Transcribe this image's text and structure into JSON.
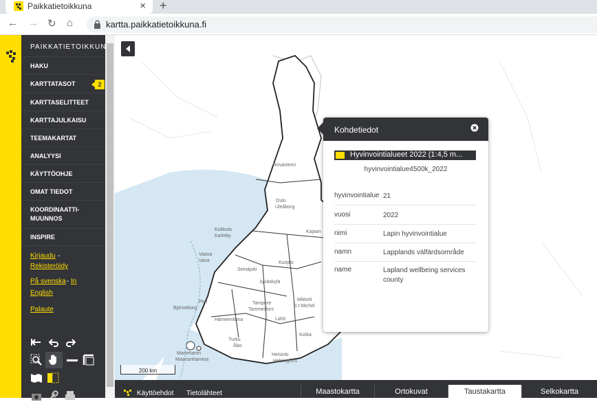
{
  "browser": {
    "tab_title": "Paikkatietoikkuna",
    "new_tab": "+",
    "close_tab": "×",
    "url": "kartta.paikkatietoikkuna.fi"
  },
  "sidebar": {
    "brand": "PAIKKATIETOIKKUNA",
    "items": [
      {
        "label": "HAKU"
      },
      {
        "label": "KARTTATASOT",
        "badge": "2"
      },
      {
        "label": "KARTTASELITTEET"
      },
      {
        "label": "KARTTAJULKAISU"
      },
      {
        "label": "TEEMAKARTAT"
      },
      {
        "label": "ANALYYSI"
      },
      {
        "label": "KÄYTTÖOHJE"
      },
      {
        "label": "OMAT TIEDOT"
      },
      {
        "label_line1": "KOORDINAATTI-",
        "label_line2": "MUUNNOS"
      },
      {
        "label": "INSPIRE"
      }
    ],
    "login": "Kirjaudu",
    "register": "Rekisteröidy",
    "lang_sv": "På svenska",
    "lang_sep": "-",
    "lang_en_1": "In",
    "lang_en_2": "English",
    "feedback": "Palaute",
    "login_sep": "-"
  },
  "map": {
    "scale": "200 km",
    "places": [
      "Rovaniemi",
      "Oulu",
      "Uleåborg",
      "Kokkola",
      "Karleby",
      "Vaasa",
      "Vasa",
      "Kajaan",
      "Seinäjoki",
      "Jyväskylä",
      "Kuopio",
      "Pori",
      "Björneborg",
      "Tampere",
      "Tammerfors",
      "Mikkeli",
      "S:t Michel",
      "Hämeenlinna",
      "Lahti",
      "Kotka",
      "Turku",
      "Åbo",
      "Mariehamn",
      "Maarianhamina",
      "Helsinki",
      "Helsingfors"
    ]
  },
  "popup": {
    "title": "Kohdetiedot",
    "layer": "Hyvinvointialueet 2022 (1:4,5 m...",
    "layer_id": "hyvinvointialue4500k_2022",
    "rows": [
      {
        "key": "hyvinvointialue",
        "value": "21"
      },
      {
        "key": "vuosi",
        "value": "2022"
      },
      {
        "key": "nimi",
        "value": "Lapin hyvinvointialue"
      },
      {
        "key": "namn",
        "value": "Lapplands välfärdsområde"
      },
      {
        "key": "name",
        "value": "Lapland wellbeing services county"
      }
    ]
  },
  "bottom": {
    "terms": "Käyttöehdot",
    "sources": "Tietolähteet",
    "backgrounds": [
      {
        "label": "Maastokartta",
        "active": false
      },
      {
        "label": "Ortokuvat",
        "active": false
      },
      {
        "label": "Taustakartta",
        "active": true
      },
      {
        "label": "Selkokartta",
        "active": false
      }
    ]
  },
  "colors": {
    "accent": "#ffde00",
    "panel": "#333438",
    "sea": "#d4e7f3"
  }
}
